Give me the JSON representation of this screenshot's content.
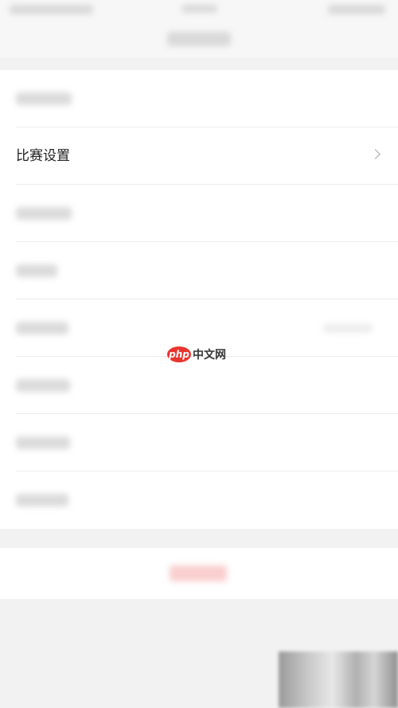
{
  "settings_row": {
    "label": "比赛设置"
  },
  "watermark": {
    "logo": "php",
    "text": "中文网",
    "brand_color": "#e8352f"
  },
  "icons": {
    "row_chevron": "chevron-right-icon"
  }
}
